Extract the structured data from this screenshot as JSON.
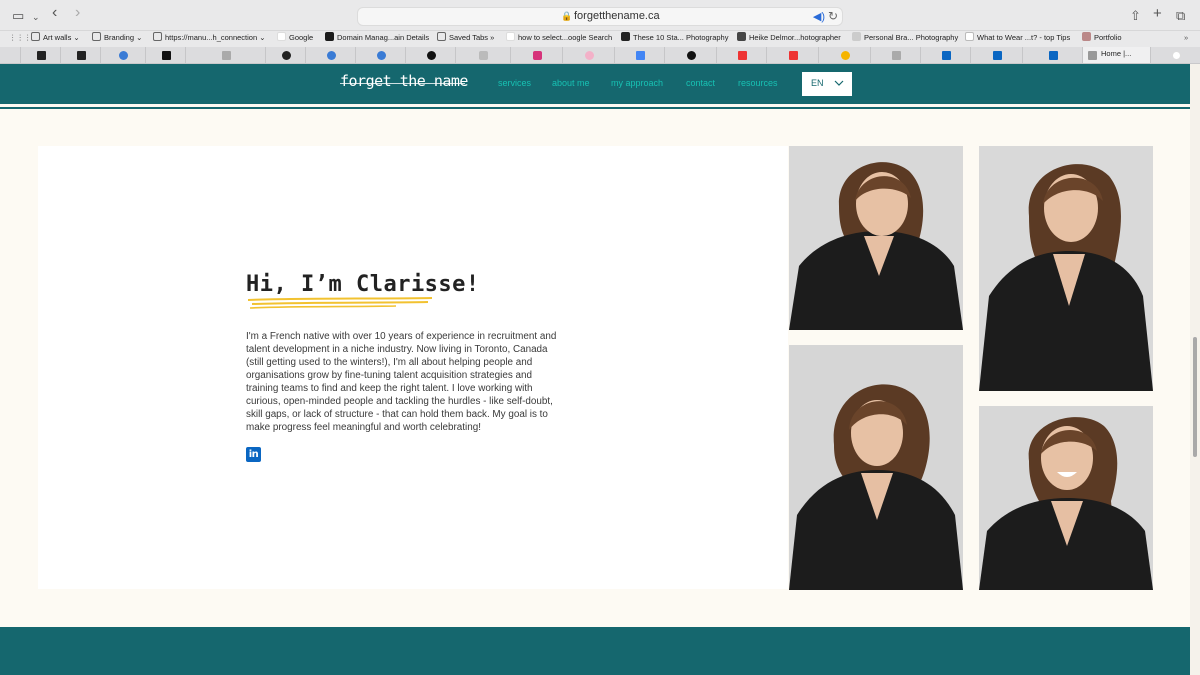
{
  "browser": {
    "url": "forgetthename.ca",
    "bookmarks": [
      "Art walls",
      "Branding",
      "https://manu...h_connection",
      "Google",
      "Domain Manag...ain Details",
      "Saved Tabs »",
      "how to select...oogle Search",
      "These 10 Sta... Photography",
      "Heike Delmor...hotographer",
      "Personal Bra... Photography",
      "What to Wear ...t? - top Tips",
      "Portfolio"
    ],
    "active_tab_title": "Home |..."
  },
  "site": {
    "brand": "forget the name",
    "nav": [
      "services",
      "about me",
      "my approach",
      "contact",
      "resources"
    ],
    "language": "EN"
  },
  "about": {
    "heading": "Hi, I’m Clarisse!",
    "bio_lines": [
      "I'm a French native with over 10 years of experience in recruitment and",
      "talent development in a niche industry. Now living in Toronto, Canada",
      "(still getting used to the winters!), I'm all about helping people and",
      "organisations grow by fine-tuning talent acquisition strategies and",
      "training teams to find and keep the right talent. I love working with",
      "curious, open-minded people and tackling the hurdles - like self-doubt,",
      "skill gaps, or lack of structure - that can hold them back. My goal is to",
      "make progress feel meaningful and worth celebrating!"
    ],
    "linkedin_label": "in"
  },
  "colors": {
    "brand_teal": "#15676e",
    "nav_teal": "#17c1b3",
    "page_bg": "#fdfaf3",
    "highlight_yellow": "#f2c230",
    "linkedin_blue": "#0a66c2"
  }
}
